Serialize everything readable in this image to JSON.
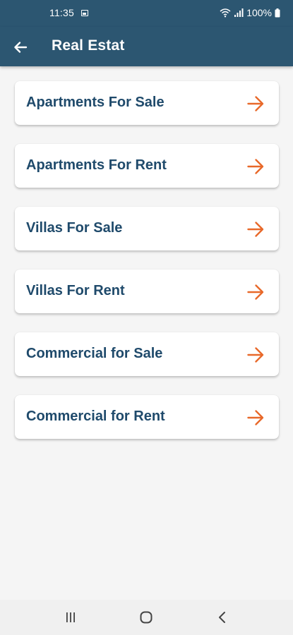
{
  "status_bar": {
    "time": "11:35",
    "battery": "100%"
  },
  "app_bar": {
    "title": "Real Estat",
    "back_icon": "arrow-left-icon"
  },
  "categories": [
    {
      "label": "Apartments For Sale",
      "icon": "arrow-right-icon"
    },
    {
      "label": "Apartments For Rent",
      "icon": "arrow-right-icon"
    },
    {
      "label": "Villas For Sale",
      "icon": "arrow-right-icon"
    },
    {
      "label": "Villas For Rent",
      "icon": "arrow-right-icon"
    },
    {
      "label": "Commercial for Sale",
      "icon": "arrow-right-icon"
    },
    {
      "label": "Commercial for Rent",
      "icon": "arrow-right-icon"
    }
  ],
  "colors": {
    "primary": "#2c5671",
    "card_text": "#1f4a6b",
    "accent_arrow": "#e8692a",
    "background": "#f5f5f5"
  },
  "nav_bar": {
    "recent_icon": "recent-apps-icon",
    "home_icon": "home-icon",
    "back_icon": "nav-back-icon"
  }
}
